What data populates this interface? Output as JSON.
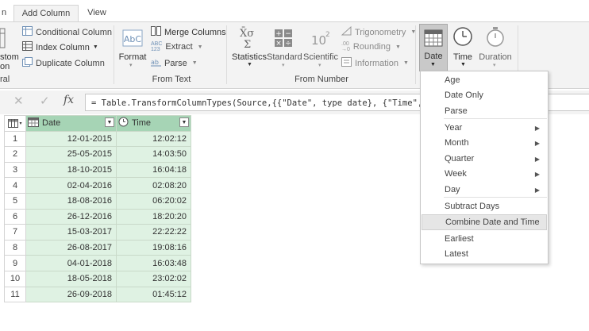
{
  "tabs": [
    {
      "label": "n"
    },
    {
      "label": "Add Column"
    },
    {
      "label": "View"
    }
  ],
  "ribbon": {
    "general_group": {
      "custom_label_1": "stom",
      "custom_label_2": "on",
      "group_label": "ral",
      "conditional_column": "Conditional Column",
      "index_column": "Index Column",
      "duplicate_column": "Duplicate Column"
    },
    "from_text": {
      "format": "Format",
      "merge_columns": "Merge Columns",
      "extract": "Extract",
      "parse": "Parse",
      "group_label": "From Text"
    },
    "from_number": {
      "statistics": "Statistics",
      "standard": "Standard",
      "scientific": "Scientific",
      "trigonometry": "Trigonometry",
      "rounding": "Rounding",
      "information": "Information",
      "group_label": "From Number"
    },
    "from_date_time": {
      "date": "Date",
      "time": "Time",
      "duration": "Duration"
    }
  },
  "formula_bar": {
    "fx": "fx",
    "formula": "= Table.TransformColumnTypes(Source,{{\"Date\", type date}, {\"Time\", type"
  },
  "grid": {
    "columns": [
      {
        "name": "Date",
        "type": "date"
      },
      {
        "name": "Time",
        "type": "time"
      }
    ],
    "rows": [
      {
        "n": "1",
        "date": "12-01-2015",
        "time": "12:02:12"
      },
      {
        "n": "2",
        "date": "25-05-2015",
        "time": "14:03:50"
      },
      {
        "n": "3",
        "date": "18-10-2015",
        "time": "16:04:18"
      },
      {
        "n": "4",
        "date": "02-04-2016",
        "time": "02:08:20"
      },
      {
        "n": "5",
        "date": "18-08-2016",
        "time": "06:20:02"
      },
      {
        "n": "6",
        "date": "26-12-2016",
        "time": "18:20:20"
      },
      {
        "n": "7",
        "date": "15-03-2017",
        "time": "22:22:22"
      },
      {
        "n": "8",
        "date": "26-08-2017",
        "time": "19:08:16"
      },
      {
        "n": "9",
        "date": "04-01-2018",
        "time": "16:03:48"
      },
      {
        "n": "10",
        "date": "18-05-2018",
        "time": "23:02:02"
      },
      {
        "n": "11",
        "date": "26-09-2018",
        "time": "01:45:12"
      }
    ]
  },
  "date_menu": {
    "items": [
      {
        "label": "Age",
        "submenu": false
      },
      {
        "label": "Date Only",
        "submenu": false
      },
      {
        "label": "Parse",
        "submenu": false
      },
      {
        "label": "Year",
        "submenu": true
      },
      {
        "label": "Month",
        "submenu": true
      },
      {
        "label": "Quarter",
        "submenu": true
      },
      {
        "label": "Week",
        "submenu": true
      },
      {
        "label": "Day",
        "submenu": true
      },
      {
        "label": "Subtract Days",
        "submenu": false
      },
      {
        "label": "Combine Date and Time",
        "submenu": false,
        "highlighted": true
      },
      {
        "label": "Earliest",
        "submenu": false
      },
      {
        "label": "Latest",
        "submenu": false
      }
    ]
  },
  "colors": {
    "ribbon_bg": "#f3f3f3",
    "header_green": "#a6d4b5",
    "cell_green": "#dff2e3",
    "menu_highlight": "#e6e6e6"
  }
}
